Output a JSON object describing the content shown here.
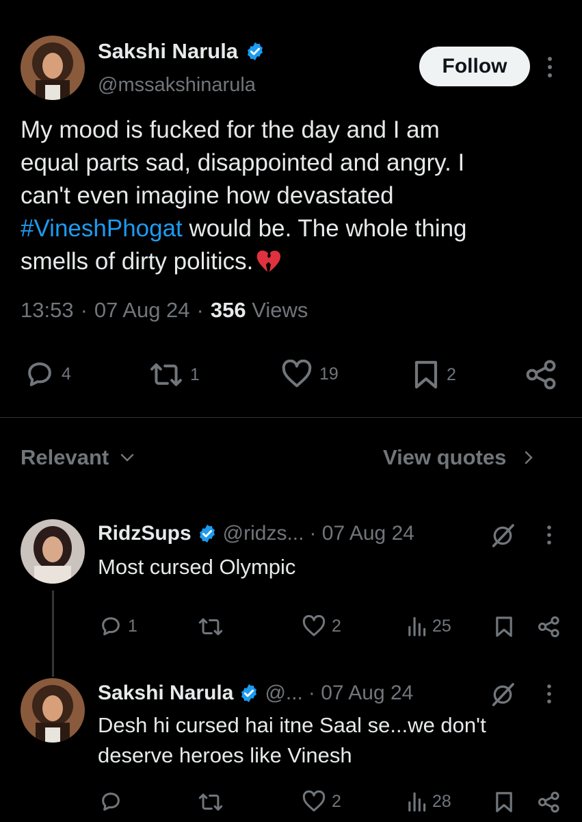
{
  "main_tweet": {
    "author_name": "Sakshi Narula",
    "handle": "@mssakshinarula",
    "follow_label": "Follow",
    "text_line1": "My mood is fucked for the day and I am",
    "text_line2": "equal parts sad, disappointed and angry. I",
    "text_line3": "can't even imagine how devastated",
    "hashtag": "#VineshPhogat",
    "text_line4_rest": " would be. The whole thing",
    "text_line5": "smells of dirty politics.",
    "emoji": "broken-heart-icon",
    "time": "13:53",
    "date": "07 Aug 24",
    "views_count": "356",
    "views_label": "Views",
    "replies": "4",
    "reposts": "1",
    "likes": "19",
    "bookmarks": "2"
  },
  "sort_bar": {
    "relevant_label": "Relevant",
    "view_quotes_label": "View quotes"
  },
  "replies": [
    {
      "author_name": "RidzSups",
      "handle": "@ridzs...",
      "date": "· 07 Aug 24",
      "text": "Most cursed Olympic",
      "replies": "1",
      "reposts": "",
      "likes": "2",
      "views": "25"
    },
    {
      "author_name": "Sakshi Narula",
      "handle": "@...",
      "date": "· 07 Aug 24",
      "text_line1": "Desh hi cursed hai itne Saal se...we don't",
      "text_line2": "deserve heroes like Vinesh",
      "replies": "",
      "reposts": "",
      "likes": "2",
      "views": "28"
    }
  ],
  "colors": {
    "background": "#000000",
    "text": "#e7e9ea",
    "muted": "#71767b",
    "link": "#1d9bf0",
    "verified": "#1d9bf0",
    "divider": "#2f3336"
  }
}
